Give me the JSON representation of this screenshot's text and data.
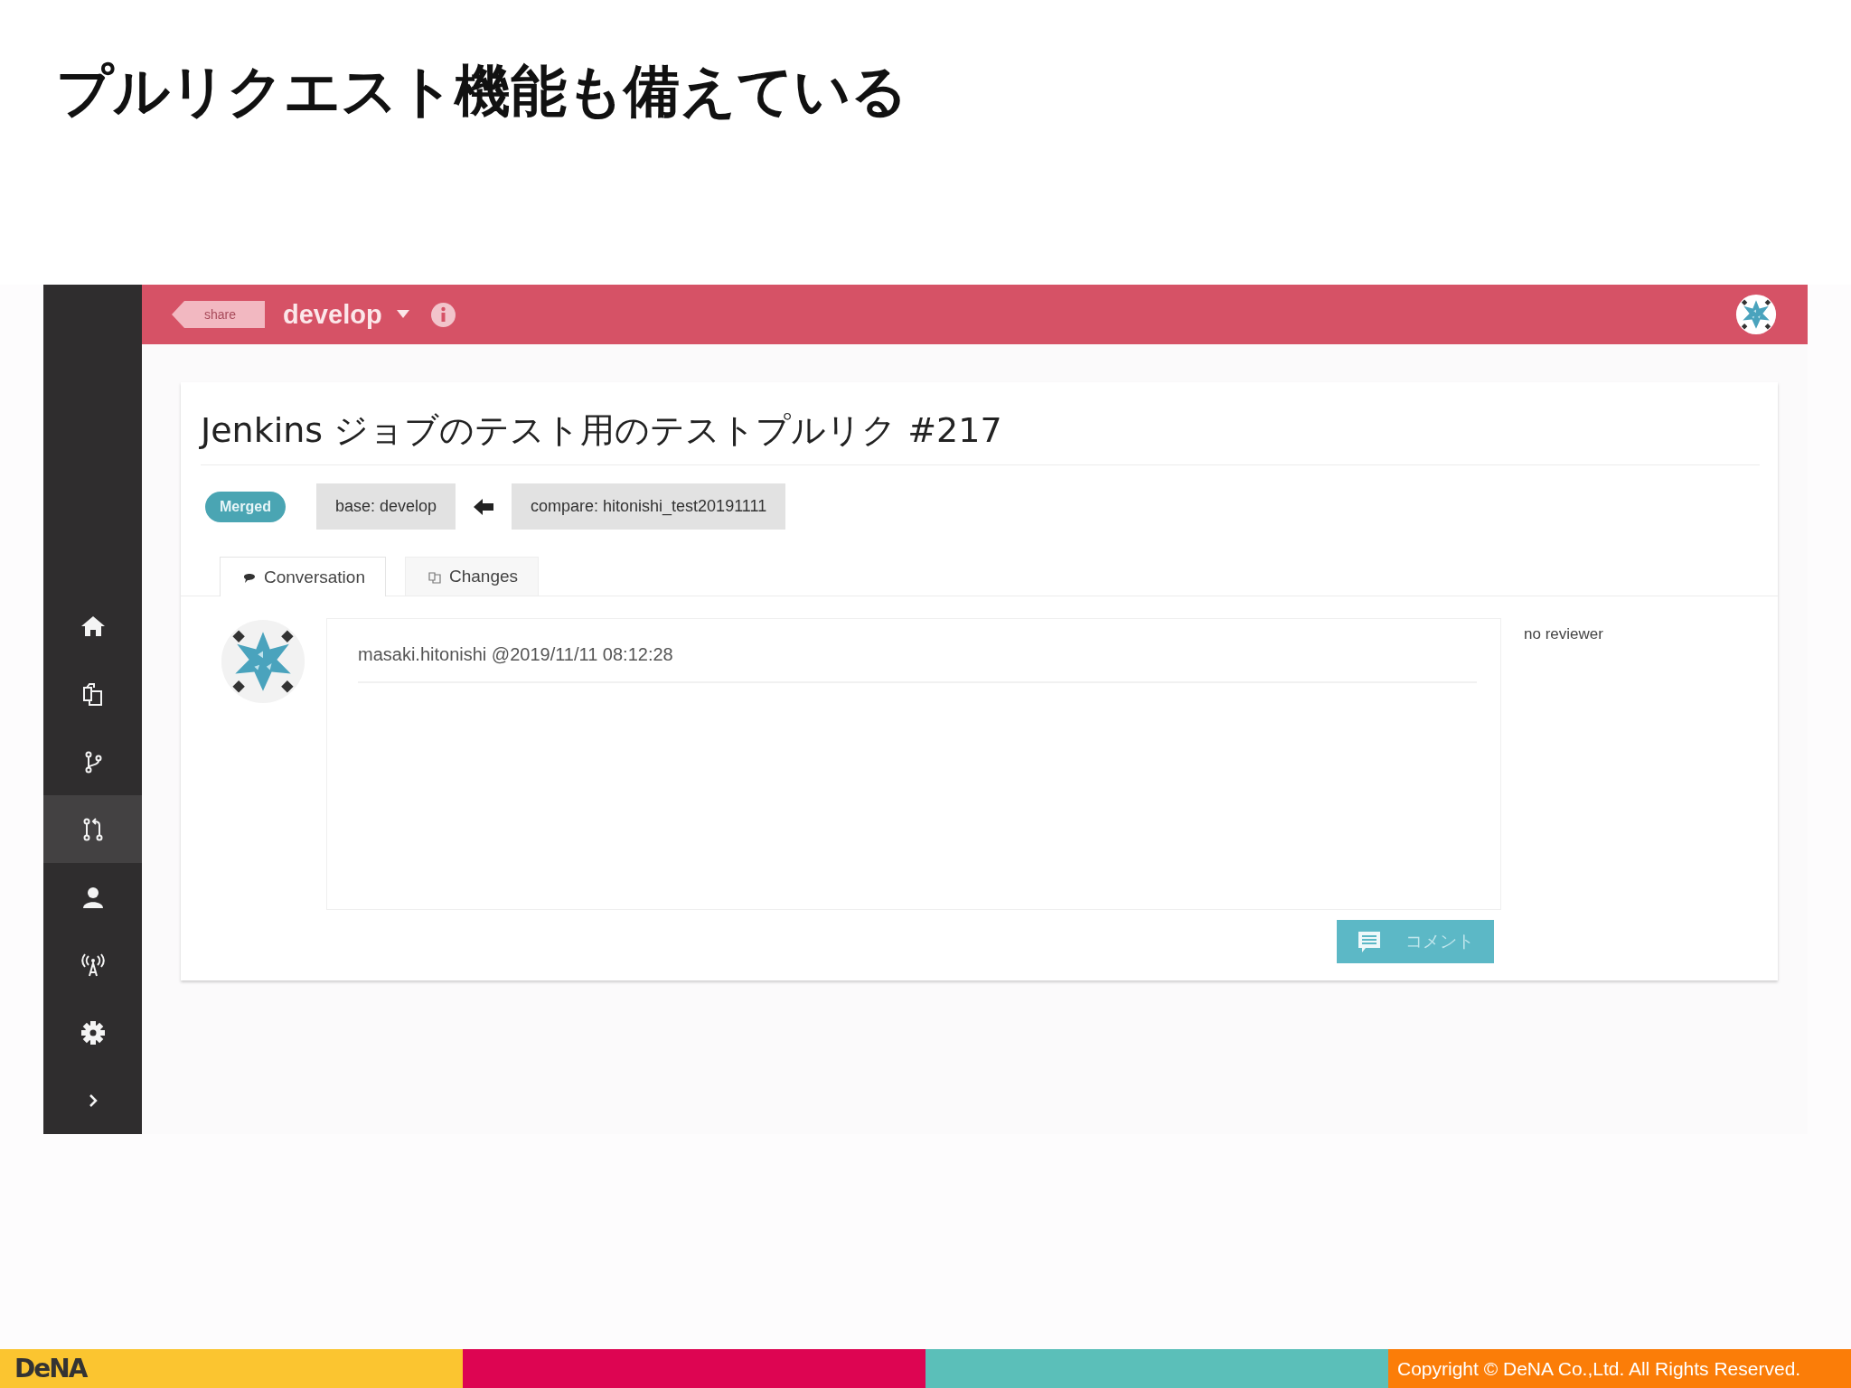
{
  "slide_title": "プルリクエスト機能も備えている",
  "app": {
    "header": {
      "share_tag": "share",
      "branch": "develop"
    },
    "sidebar": {
      "items": [
        {
          "selected": false
        },
        {
          "selected": false
        },
        {
          "selected": false
        },
        {
          "selected": true
        },
        {
          "selected": false
        },
        {
          "selected": false
        },
        {
          "selected": false
        }
      ]
    },
    "pull_request": {
      "title": "Jenkins ジョブのテスト用のテストプルリク #217",
      "status": "Merged",
      "base": "base: develop",
      "compare": "compare: hitonishi_test20191111",
      "tabs": [
        {
          "label": "Conversation",
          "selected": true
        },
        {
          "label": "Changes",
          "selected": false
        }
      ],
      "comment": {
        "author_time": "masaki.hitonishi @2019/11/11 08:12:28"
      },
      "comment_button": "コメント",
      "reviewer": "no reviewer"
    }
  },
  "footer": {
    "logo": "DeNA",
    "copyright": "Copyright © DeNA Co.,Ltd. All Rights Reserved."
  }
}
